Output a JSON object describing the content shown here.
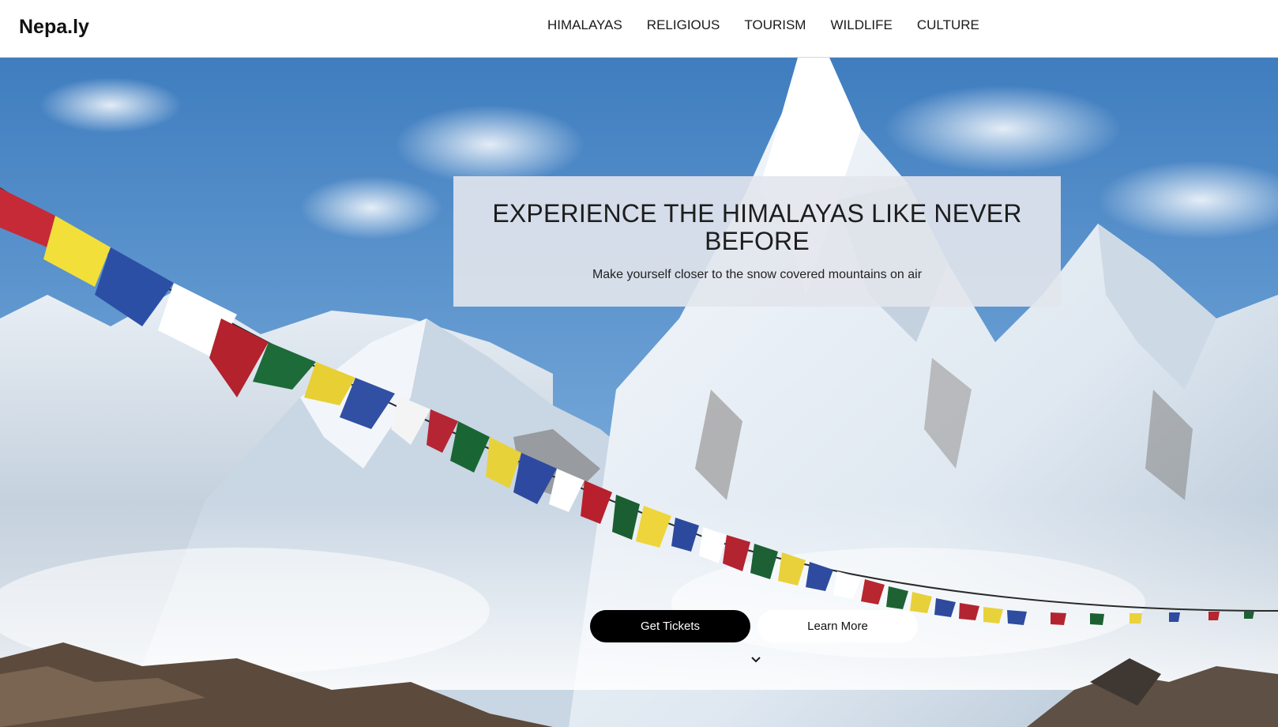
{
  "header": {
    "brand": "Nepa.ly",
    "nav": [
      {
        "label": "HIMALAYAS"
      },
      {
        "label": "RELIGIOUS"
      },
      {
        "label": "TOURISM"
      },
      {
        "label": "WILDLIFE"
      },
      {
        "label": "CULTURE"
      }
    ]
  },
  "hero": {
    "title": "EXPERIENCE THE HIMALAYAS LIKE NEVER BEFORE",
    "subtitle": "Make yourself closer to the snow covered mountains on air",
    "primary_button": "Get Tickets",
    "secondary_button": "Learn More",
    "scroll_icon": "chevron-down-icon",
    "background_image": "snow-capped Himalayan peaks with colourful prayer flags"
  },
  "colors": {
    "sky": "#4a86c6",
    "snow": "#eef3f8",
    "rock": "#6b5a4a",
    "button_primary": "#000000",
    "button_secondary": "#ffffff"
  }
}
